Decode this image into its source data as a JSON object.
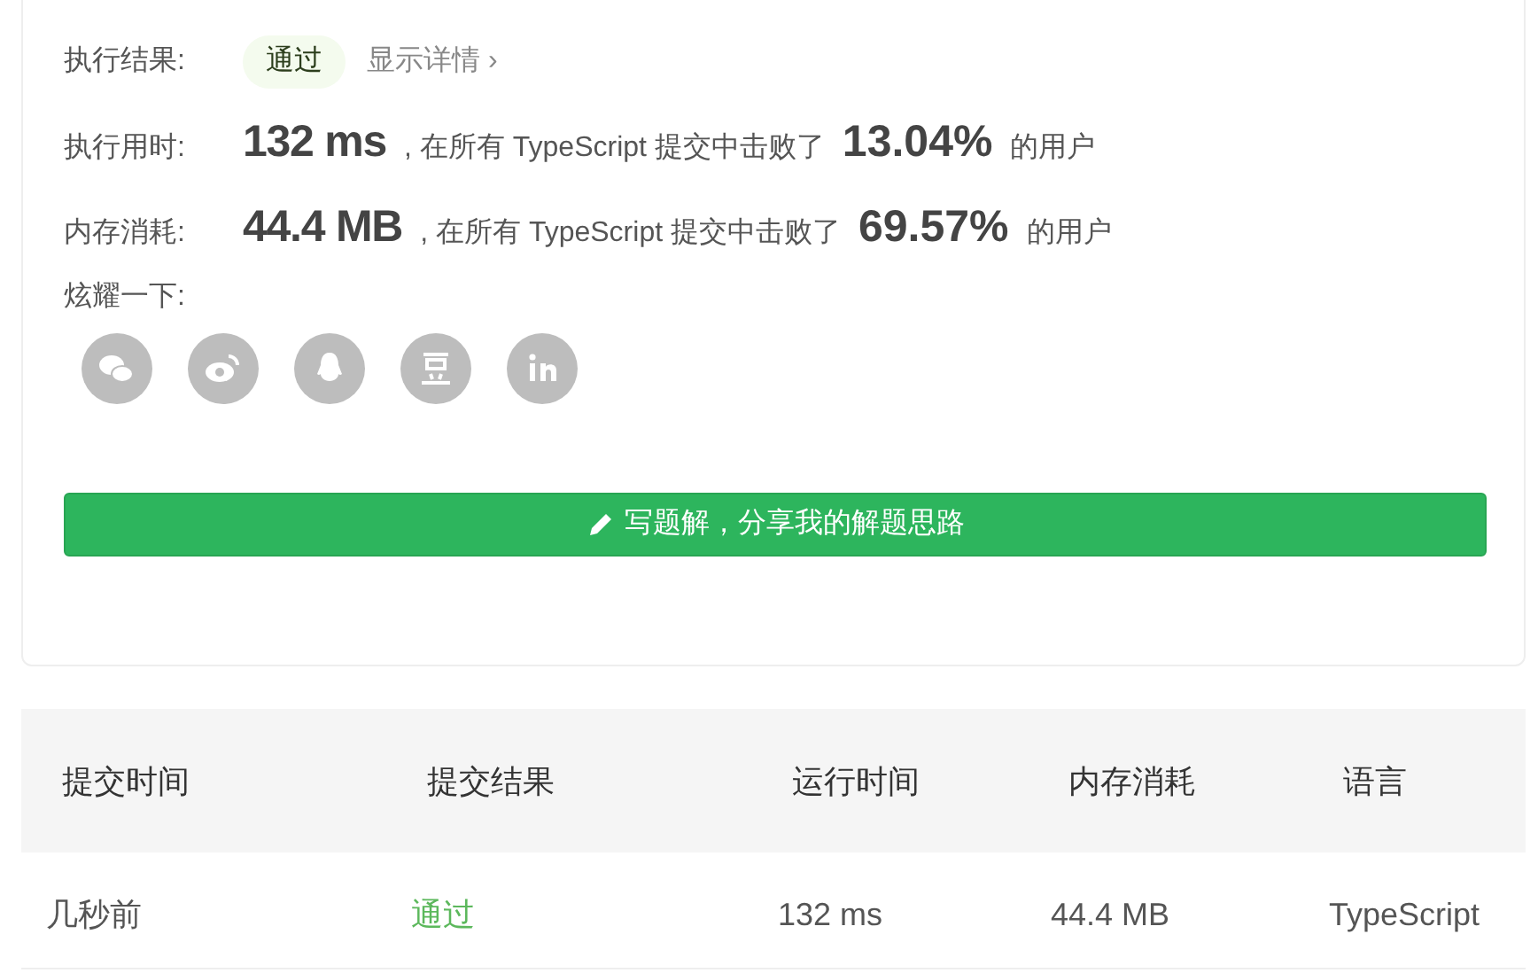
{
  "result": {
    "label": "执行结果:",
    "status": "通过",
    "details_link": "显示详情 ›"
  },
  "stats": [
    {
      "label": "执行用时:",
      "value": "132 ms",
      "text": ", 在所有 TypeScript 提交中击败了",
      "percent": "13.04%",
      "suffix": "的用户"
    },
    {
      "label": "内存消耗:",
      "value": "44.4 MB",
      "text": ", 在所有 TypeScript 提交中击败了",
      "percent": "69.57%",
      "suffix": "的用户"
    }
  ],
  "share": {
    "label": "炫耀一下:",
    "icons": [
      {
        "kind": "wechat"
      },
      {
        "kind": "weibo"
      },
      {
        "kind": "qq"
      },
      {
        "kind": "douban"
      },
      {
        "kind": "linkedin"
      }
    ]
  },
  "write_button": "写题解，分享我的解题思路",
  "table": {
    "columns": [
      "提交时间",
      "提交结果",
      "运行时间",
      "内存消耗",
      "语言"
    ],
    "rows": [
      {
        "time": "几秒前",
        "result": "通过",
        "runtime": "132 ms",
        "memory": "44.4 MB",
        "language": "TypeScript"
      }
    ]
  }
}
